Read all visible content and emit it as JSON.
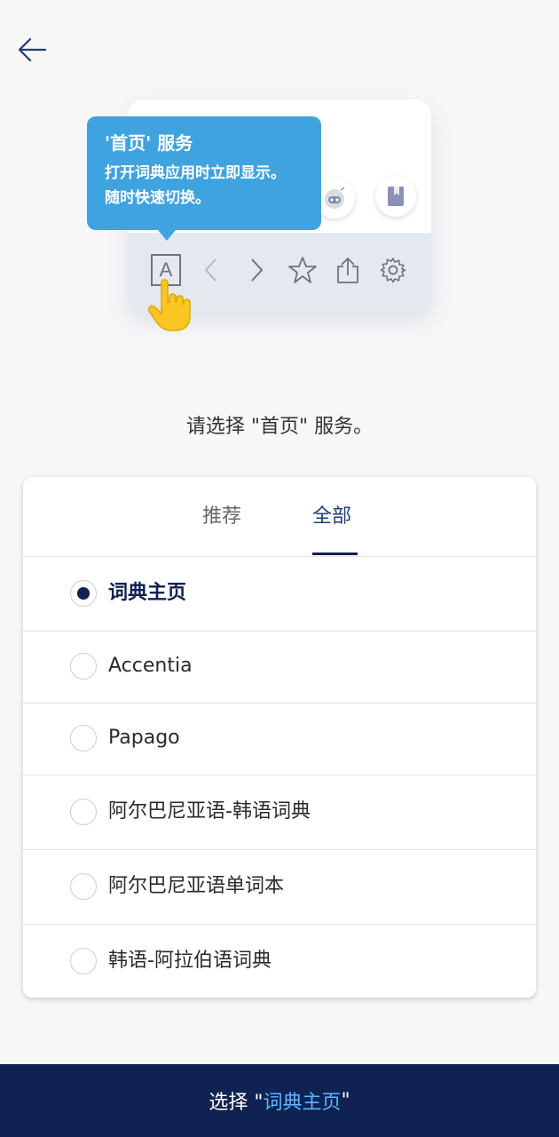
{
  "colors": {
    "primary": "#0f2251",
    "tooltip": "#3fa3e0",
    "highlight": "#5bb6ff"
  },
  "header": {
    "back_icon": "arrow-left-icon"
  },
  "illustration": {
    "tooltip_title": "'首页' 服务",
    "tooltip_desc": "打开词典应用时立即显示。\n随时快速切换。",
    "toolbar_letter": "A",
    "toolbar_icons": [
      "letter-a-icon",
      "chevron-left-icon",
      "chevron-right-icon",
      "star-icon",
      "share-icon",
      "gear-icon"
    ]
  },
  "prompt": "请选择 \"首页\" 服务。",
  "tabs": [
    {
      "label": "推荐",
      "active": false
    },
    {
      "label": "全部",
      "active": true
    }
  ],
  "options": [
    {
      "label": "词典主页",
      "selected": true
    },
    {
      "label": "Accentia",
      "selected": false
    },
    {
      "label": "Papago",
      "selected": false
    },
    {
      "label": "阿尔巴尼亚语-韩语词典",
      "selected": false
    },
    {
      "label": "阿尔巴尼亚语单词本",
      "selected": false
    },
    {
      "label": "韩语-阿拉伯语词典",
      "selected": false
    }
  ],
  "select_button": {
    "prefix": "选择 \"",
    "highlight": "词典主页",
    "suffix": "\""
  }
}
